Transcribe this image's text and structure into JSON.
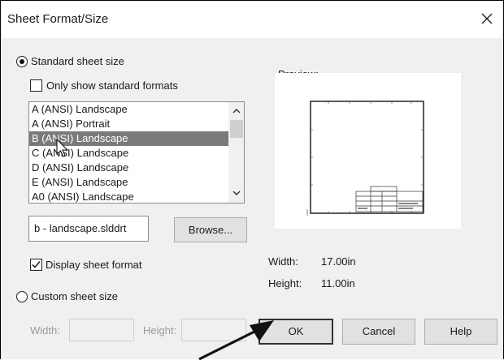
{
  "dialog": {
    "title": "Sheet Format/Size"
  },
  "standard": {
    "radio_label": "Standard sheet size",
    "only_standard_label": "Only show standard formats",
    "formats": [
      "A (ANSI) Landscape",
      "A (ANSI) Portrait",
      "B (ANSI) Landscape",
      "C (ANSI) Landscape",
      "D (ANSI) Landscape",
      "E (ANSI) Landscape",
      "A0 (ANSI) Landscape"
    ],
    "selected_index": 2,
    "file_value": "b - landscape.slddrt",
    "browse_label": "Browse...",
    "display_format_label": "Display sheet format"
  },
  "preview": {
    "label": "Preview:",
    "width_label": "Width:",
    "width_value": "17.00in",
    "height_label": "Height:",
    "height_value": "11.00in"
  },
  "custom": {
    "radio_label": "Custom sheet size",
    "width_label": "Width:",
    "height_label": "Height:"
  },
  "buttons": {
    "ok": "OK",
    "cancel": "Cancel",
    "help": "Help"
  },
  "icons": {
    "close": "close-icon",
    "cursor": "mouse-pointer-icon",
    "annotation": "annotation-arrow-icon"
  },
  "colors": {
    "selected_row": "#7a7a7a",
    "dialog_bg": "#f0f0f0"
  }
}
